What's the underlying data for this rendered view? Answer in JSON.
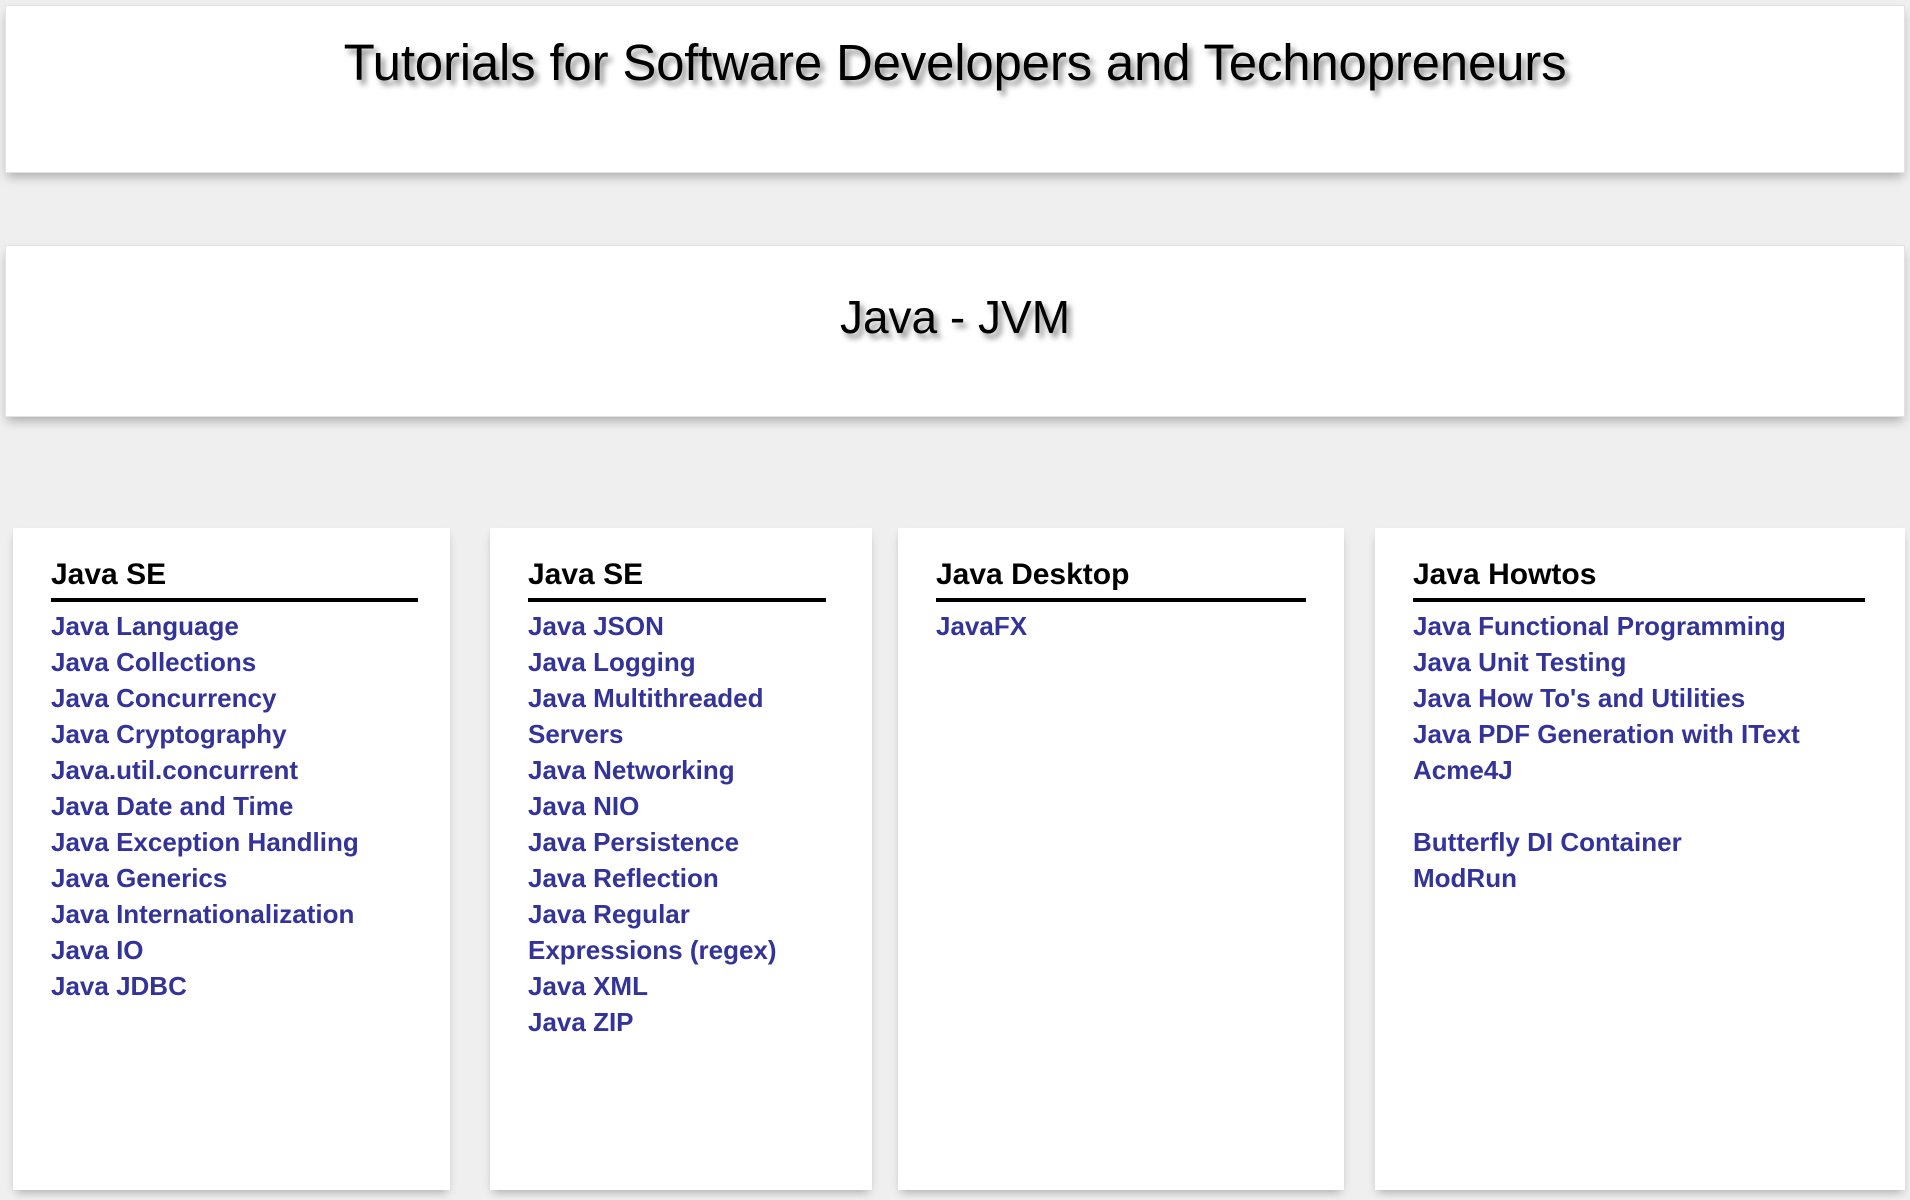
{
  "site": {
    "title": "Tutorials for Software Developers and Technopreneurs"
  },
  "page": {
    "title": "Java - JVM"
  },
  "colors": {
    "link": "#333399",
    "heading": "#000000",
    "background": "#efefef",
    "card_background": "#ffffff"
  },
  "columns": [
    {
      "heading": "Java SE",
      "links": [
        {
          "label": "Java Language"
        },
        {
          "label": "Java Collections"
        },
        {
          "label": "Java Concurrency"
        },
        {
          "label": "Java Cryptography"
        },
        {
          "label": "Java.util.concurrent"
        },
        {
          "label": "Java Date and Time"
        },
        {
          "label": "Java Exception Handling"
        },
        {
          "label": "Java Generics"
        },
        {
          "label": "Java Internationalization"
        },
        {
          "label": "Java IO"
        },
        {
          "label": "Java JDBC"
        }
      ]
    },
    {
      "heading": "Java SE",
      "links": [
        {
          "label": "Java JSON"
        },
        {
          "label": "Java Logging"
        },
        {
          "label": "Java Multithreaded Servers"
        },
        {
          "label": "Java Networking"
        },
        {
          "label": "Java NIO"
        },
        {
          "label": "Java Persistence"
        },
        {
          "label": "Java Reflection"
        },
        {
          "label": "Java Regular Expressions (regex)"
        },
        {
          "label": "Java XML"
        },
        {
          "label": "Java ZIP"
        }
      ]
    },
    {
      "heading": "Java Desktop",
      "links": [
        {
          "label": "JavaFX"
        }
      ]
    },
    {
      "heading": "Java Howtos",
      "links": [
        {
          "label": "Java Functional Programming"
        },
        {
          "label": "Java Unit Testing"
        },
        {
          "label": "Java How To's and Utilities"
        },
        {
          "label": "Java PDF Generation with IText"
        },
        {
          "label": "Acme4J"
        },
        {
          "label": "Butterfly DI Container",
          "gap_before": true
        },
        {
          "label": "ModRun"
        }
      ]
    }
  ]
}
